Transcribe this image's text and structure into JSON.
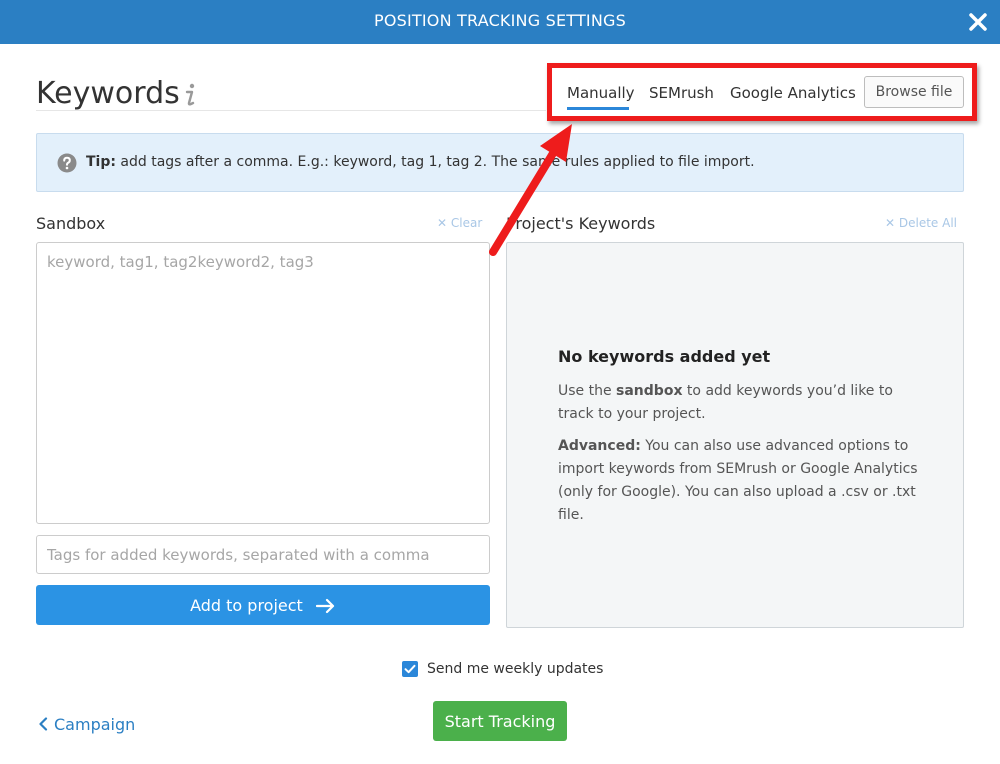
{
  "header": {
    "title": "POSITION TRACKING SETTINGS",
    "close_symbol": "✕"
  },
  "section": {
    "title": "Keywords"
  },
  "tabs": [
    {
      "label": "Manually",
      "active": true
    },
    {
      "label": "SEMrush"
    },
    {
      "label": "Google Analytics"
    }
  ],
  "browse_button": {
    "label": "Browse file"
  },
  "tip": {
    "strong": "Tip:",
    "text": "add tags after a comma. E.g.: keyword, tag 1, tag 2. The same rules applied to file import."
  },
  "sandbox": {
    "label": "Sandbox",
    "clear_label": "✕ Clear",
    "placeholder": "keyword, tag1, tag2keyword2, tag3",
    "tags_placeholder": "Tags for added keywords, separated with a comma",
    "add_button_label": "Add to project"
  },
  "project_keywords": {
    "label": "Project's Keywords",
    "delete_all_label": "✕ Delete All",
    "empty_title": "No keywords added yet",
    "p1_before": "Use the ",
    "p1_bold": "sandbox",
    "p1_after": " to add keywords you’d like to track to your project.",
    "p2_bold": "Advanced:",
    "p2_text": " You can also use advanced options to import keywords from SEMrush or Google Analytics (only for Google). You can also upload a .csv or .txt file."
  },
  "footer": {
    "weekly_updates_label": "Send me weekly updates",
    "weekly_updates_checked": true,
    "campaign_link": "Campaign",
    "start_button": "Start Tracking"
  },
  "colors": {
    "header_bg": "#2b7fc3",
    "primary_blue": "#2b93e4",
    "start_green": "#4bb04b",
    "annotation_red": "#ee1c1c"
  }
}
